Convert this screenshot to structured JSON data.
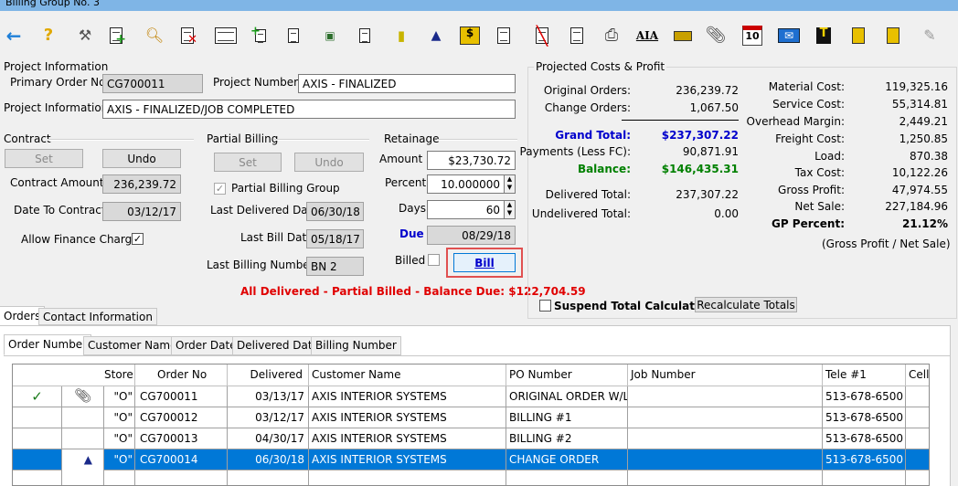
{
  "window": {
    "title": "Billing Group No. 3"
  },
  "toolbar": {
    "icons": [
      "back-arrow-icon",
      "help-icon",
      "tools-icon",
      "add-document-icon",
      "search-icon",
      "delete-document-icon",
      "document-list-icon",
      "add-item-icon",
      "copy-documents-icon",
      "money-icon",
      "document-icon",
      "note-icon",
      "triangle-icon",
      "document-dollar-icon",
      "edit-document-icon",
      "cancel-document-icon",
      "document-search-icon",
      "printer-icon",
      "aia-icon",
      "ticket-icon",
      "paperclip-icon",
      "calendar-icon",
      "email-icon",
      "t-icon",
      "notebook-icon",
      "yellow-note-icon",
      "pen-icon"
    ],
    "aia_label": "AIA",
    "calendar_label": "10",
    "t_label": "T"
  },
  "project": {
    "section_label": "Project Information",
    "primary_order_label": "Primary Order No",
    "primary_order_value": "CG700011",
    "project_number_label": "Project Number",
    "project_number_value": "AXIS - FINALIZED",
    "project_info_label": "Project Information",
    "project_info_value": "AXIS - FINALIZED/JOB COMPLETED"
  },
  "contract": {
    "section_label": "Contract",
    "set_label": "Set",
    "undo_label": "Undo",
    "amount_label": "Contract Amount",
    "amount_value": "236,239.72",
    "date_label": "Date To Contract",
    "date_value": "03/12/17",
    "finance_label": "Allow Finance Charge",
    "finance_checked": true
  },
  "partial": {
    "section_label": "Partial Billing",
    "set_label": "Set",
    "undo_label": "Undo",
    "group_label": "Partial Billing Group",
    "group_checked": true,
    "last_delivered_label": "Last Delivered Date",
    "last_delivered_value": "06/30/18",
    "last_bill_label": "Last Bill Date",
    "last_bill_value": "05/18/17",
    "last_number_label": "Last Billing Number",
    "last_number_value": "BN 2"
  },
  "retainage": {
    "section_label": "Retainage",
    "amount_label": "Amount",
    "amount_value": "$23,730.72",
    "percent_label": "Percent",
    "percent_value": "10.000000",
    "days_label": "Days",
    "days_value": "60",
    "due_label": "Due",
    "due_value": "08/29/18",
    "billed_label": "Billed",
    "billed_checked": false,
    "bill_button": "Bill"
  },
  "status_message": "All Delivered - Partial Billed - Balance Due: $122,704.59",
  "costs": {
    "section_label": "Projected Costs & Profit",
    "left": [
      {
        "label": "Original Orders:",
        "value": "236,239.72",
        "style": "normal"
      },
      {
        "label": "Change Orders:",
        "value": "1,067.50",
        "style": "normal"
      },
      {
        "label": "Grand Total:",
        "value": "$237,307.22",
        "style": "blue"
      },
      {
        "label": "Payments (Less FC):",
        "value": "90,871.91",
        "style": "normal"
      },
      {
        "label": "Balance:",
        "value": "$146,435.31",
        "style": "green"
      },
      {
        "label": "Delivered Total:",
        "value": "237,307.22",
        "style": "normal"
      },
      {
        "label": "Undelivered Total:",
        "value": "0.00",
        "style": "normal"
      }
    ],
    "right": [
      {
        "label": "Material Cost:",
        "value": "119,325.16"
      },
      {
        "label": "Service Cost:",
        "value": "55,314.81"
      },
      {
        "label": "Overhead Margin:",
        "value": "2,449.21"
      },
      {
        "label": "Freight Cost:",
        "value": "1,250.85"
      },
      {
        "label": "Load:",
        "value": "870.38"
      },
      {
        "label": "Tax Cost:",
        "value": "10,122.26"
      },
      {
        "label": "Gross Profit:",
        "value": "47,974.55"
      },
      {
        "label": "Net Sale:",
        "value": "227,184.96"
      },
      {
        "label": "GP Percent:",
        "value": "21.12%"
      }
    ],
    "gp_note": "(Gross Profit / Net Sale)",
    "suspend_label": "Suspend Total Calculations",
    "suspend_checked": false,
    "recalc_button": "Recalculate Totals"
  },
  "main_tabs": [
    "Orders",
    "Contact Information"
  ],
  "sort_tabs": [
    "Order Number",
    "Customer Name",
    "Order Date",
    "Delivered Date",
    "Billing Number"
  ],
  "grid": {
    "columns": [
      "Store",
      "Order No",
      "Delivered",
      "Customer Name",
      "PO Number",
      "Job Number",
      "Tele #1",
      "Cell"
    ],
    "rows": [
      {
        "store": "\"O\"",
        "order": "CG700011",
        "delivered": "03/13/17",
        "customer": "AXIS INTERIOR SYSTEMS",
        "po": "ORIGINAL ORDER W/LAB",
        "job": "",
        "tele": "513-678-6500",
        "cell": "",
        "check": true,
        "clip": true,
        "tri": false,
        "selected": false
      },
      {
        "store": "\"O\"",
        "order": "CG700012",
        "delivered": "03/12/17",
        "customer": "AXIS INTERIOR SYSTEMS",
        "po": "BILLING #1",
        "job": "",
        "tele": "513-678-6500",
        "cell": "",
        "check": false,
        "clip": false,
        "tri": false,
        "selected": false
      },
      {
        "store": "\"O\"",
        "order": "CG700013",
        "delivered": "04/30/17",
        "customer": "AXIS INTERIOR SYSTEMS",
        "po": "BILLING #2",
        "job": "",
        "tele": "513-678-6500",
        "cell": "",
        "check": false,
        "clip": false,
        "tri": false,
        "selected": false
      },
      {
        "store": "\"O\"",
        "order": "CG700014",
        "delivered": "06/30/18",
        "customer": "AXIS INTERIOR SYSTEMS",
        "po": "CHANGE ORDER",
        "job": "",
        "tele": "513-678-6500",
        "cell": "",
        "check": false,
        "clip": false,
        "tri": true,
        "selected": true
      }
    ]
  },
  "colors": {
    "accent": "#0078d7",
    "alert": "#e00000",
    "highlight_border": "#e05050",
    "grand_total": "#0000cc",
    "balance": "#008000"
  }
}
